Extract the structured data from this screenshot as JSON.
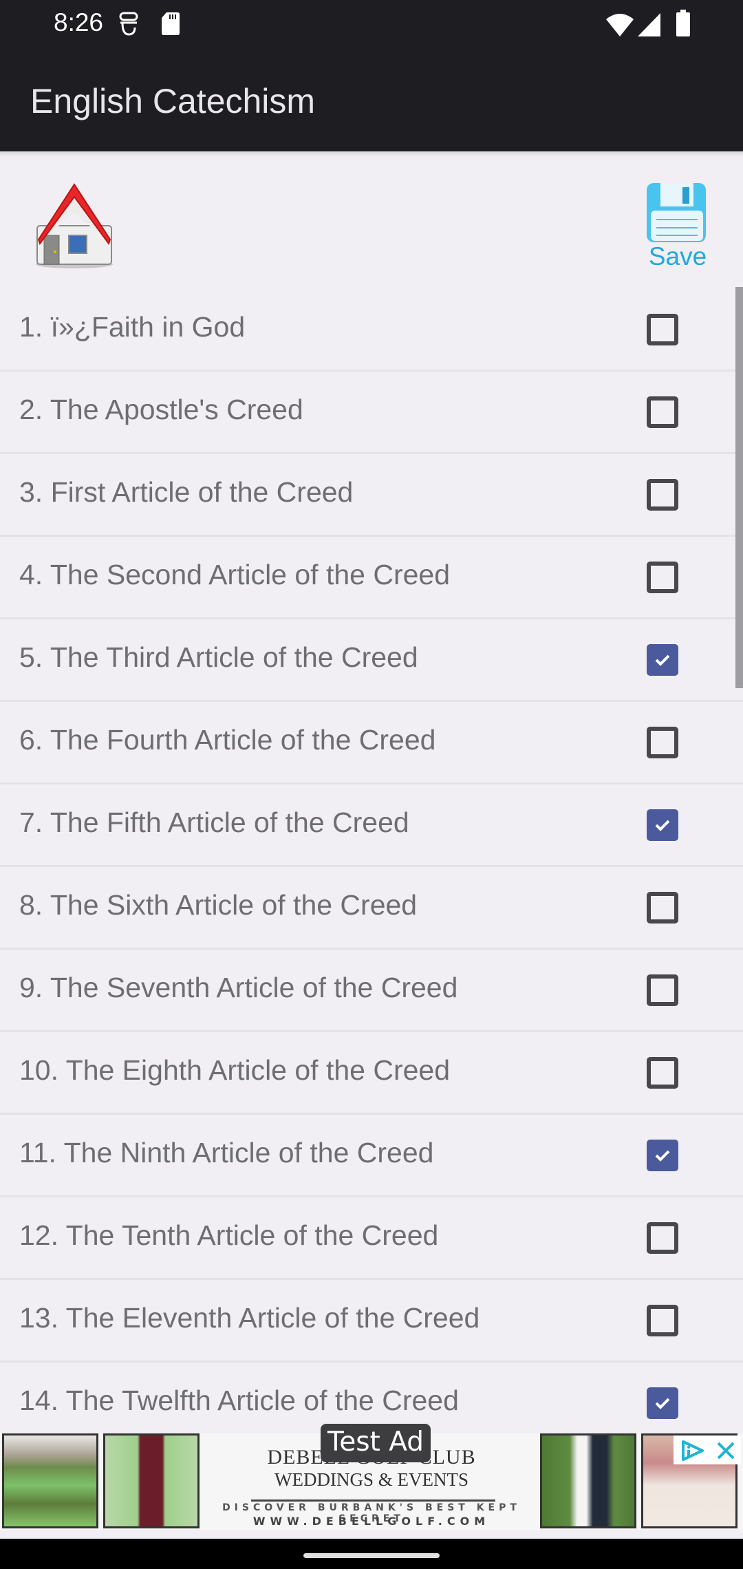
{
  "status_bar": {
    "time": "8:26",
    "left_icons": [
      "vpn-key-icon",
      "sd-card-icon"
    ],
    "right_icons": [
      "wifi-icon",
      "signal-icon",
      "battery-icon"
    ]
  },
  "app_bar": {
    "title": "English Catechism"
  },
  "toolbar": {
    "home_icon": "house-icon",
    "save_icon": "floppy-disk-icon",
    "save_label": "Save"
  },
  "lessons": [
    {
      "label": "1. ï»¿Faith in God",
      "checked": false
    },
    {
      "label": "2. The Apostle's Creed",
      "checked": false
    },
    {
      "label": "3. First Article of the Creed",
      "checked": false
    },
    {
      "label": "4. The Second Article of the Creed",
      "checked": false
    },
    {
      "label": "5. The Third Article of the Creed",
      "checked": true
    },
    {
      "label": "6. The Fourth Article of the Creed",
      "checked": false
    },
    {
      "label": "7. The Fifth Article of the Creed",
      "checked": true
    },
    {
      "label": "8. The Sixth Article of the Creed",
      "checked": false
    },
    {
      "label": "9. The Seventh Article of the Creed",
      "checked": false
    },
    {
      "label": "10. The Eighth Article of the Creed",
      "checked": false
    },
    {
      "label": "11. The Ninth Article of the Creed",
      "checked": true
    },
    {
      "label": "12. The Tenth Article of the Creed",
      "checked": false
    },
    {
      "label": "13. The Eleventh Article of the Creed",
      "checked": false
    },
    {
      "label": "14. The Twelfth Article of the Creed",
      "checked": true
    }
  ],
  "ad": {
    "badge": "Test Ad",
    "name": "DEBELL GOLF CLUB",
    "subtitle": "WEDDINGS & EVENTS",
    "tagline": "DISCOVER BURBANK'S BEST KEPT SECRET",
    "url": "WWW.DEBELLGOLF.COM"
  },
  "colors": {
    "app_bar": "#1e1e22",
    "background": "#f1eff3",
    "checkbox_checked": "#4a5a9c",
    "save_accent": "#1fa9de",
    "label_text": "#6e6d72"
  }
}
